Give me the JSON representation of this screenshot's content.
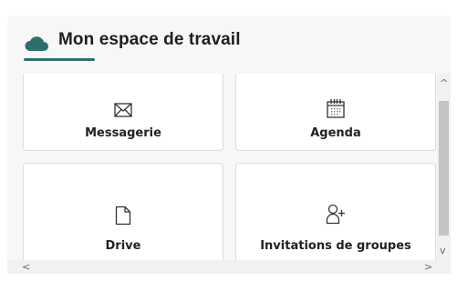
{
  "widget": {
    "title": "Mon espace de travail",
    "icon": "cloud-icon",
    "accent_color": "#2d6f6b"
  },
  "tiles": [
    {
      "label": "Messagerie",
      "icon": "envelope-icon"
    },
    {
      "label": "Agenda",
      "icon": "calendar-icon"
    },
    {
      "label": "Drive",
      "icon": "document-icon"
    },
    {
      "label": "Invitations de groupes",
      "icon": "add-user-icon"
    }
  ],
  "scrollbars": {
    "up": "^",
    "down": "v",
    "left": "<",
    "right": ">"
  }
}
